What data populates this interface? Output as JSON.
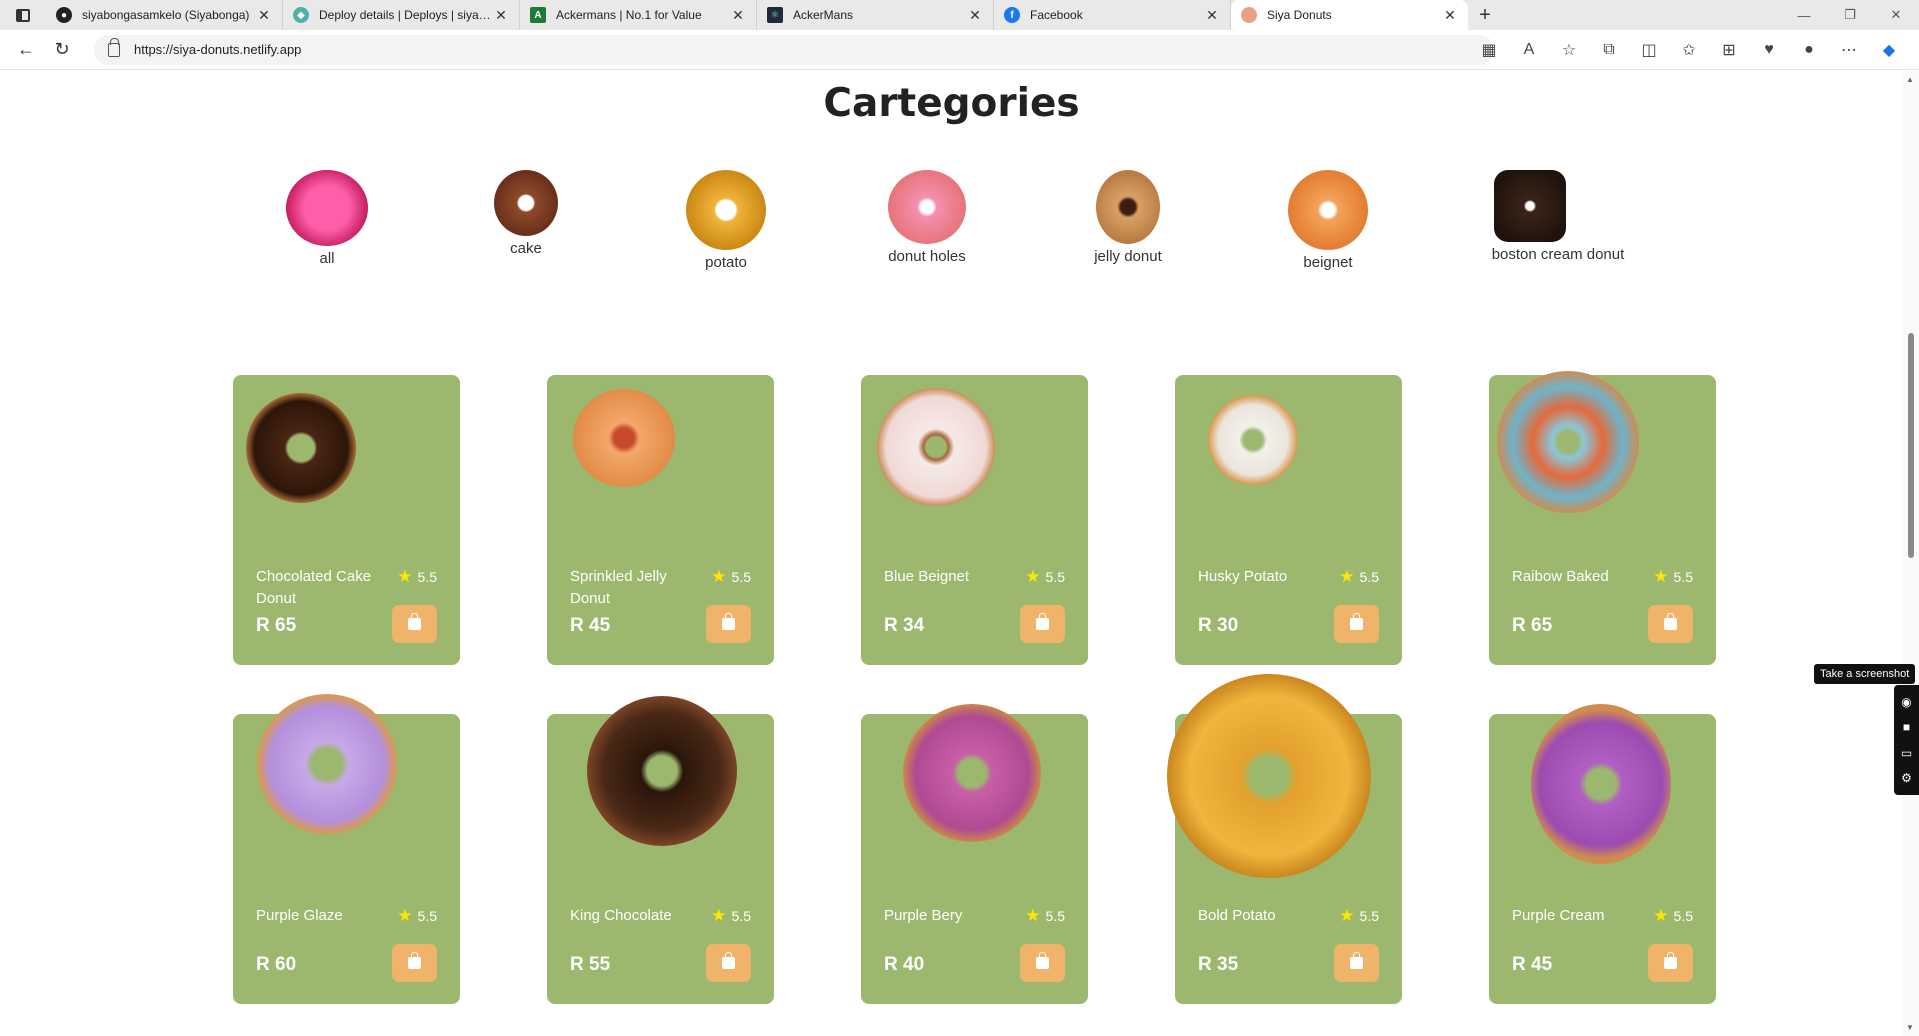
{
  "browser": {
    "tabs": [
      {
        "title": "siyabongasamkelo (Siyabonga)",
        "icon": "github-icon",
        "color": "#222222",
        "active": false
      },
      {
        "title": "Deploy details | Deploys | siya-sh",
        "icon": "netlify-icon",
        "color": "#4fb0a8",
        "active": false
      },
      {
        "title": "Ackermans | No.1 for Value",
        "icon": "ackermans-icon",
        "color": "#1f7a3a",
        "active": false
      },
      {
        "title": "AckerMans",
        "icon": "react-icon",
        "color": "#222a38",
        "active": false
      },
      {
        "title": "Facebook",
        "icon": "facebook-icon",
        "color": "#1877f2",
        "active": false
      },
      {
        "title": "Siya Donuts",
        "icon": "donut-icon",
        "color": "#e7a189",
        "active": true
      }
    ],
    "url": "https://siya-donuts.netlify.app"
  },
  "page": {
    "title": "Cartegories",
    "categories": [
      {
        "label": "all"
      },
      {
        "label": "cake"
      },
      {
        "label": "potato"
      },
      {
        "label": "donut holes"
      },
      {
        "label": "jelly donut"
      },
      {
        "label": "beignet"
      },
      {
        "label": "boston cream donut"
      }
    ],
    "products": [
      {
        "name": "Chocolated Cake Donut",
        "rating": "5.5",
        "price": "R 65"
      },
      {
        "name": "Sprinkled Jelly Donut",
        "rating": "5.5",
        "price": "R 45"
      },
      {
        "name": "Blue Beignet",
        "rating": "5.5",
        "price": "R 34"
      },
      {
        "name": "Husky Potato",
        "rating": "5.5",
        "price": "R 30"
      },
      {
        "name": "Raibow Baked",
        "rating": "5.5",
        "price": "R 65"
      },
      {
        "name": "Purple Glaze",
        "rating": "5.5",
        "price": "R 60"
      },
      {
        "name": "King Chocolate",
        "rating": "5.5",
        "price": "R 55"
      },
      {
        "name": "Purple Bery",
        "rating": "5.5",
        "price": "R 40"
      },
      {
        "name": "Bold Potato",
        "rating": "5.5",
        "price": "R 35"
      },
      {
        "name": "Purple Cream",
        "rating": "5.5",
        "price": "R 45"
      }
    ]
  },
  "overlay": {
    "tooltip": "Take a screenshot"
  },
  "colors": {
    "card_bg": "#9cb86e",
    "cart_button": "#f0b36a",
    "star": "#ffe600"
  }
}
